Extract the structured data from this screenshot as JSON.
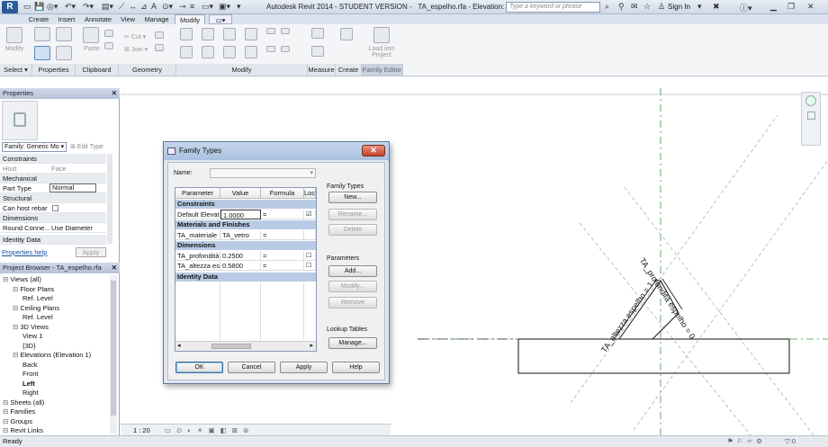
{
  "app": {
    "title": "Autodesk Revit 2014 - STUDENT VERSION -",
    "file": "TA_espelho.rfa - Elevation: Left",
    "app_button": "R"
  },
  "search": {
    "placeholder": "Type a keyword or phrase"
  },
  "user": {
    "sign_in": "Sign In"
  },
  "tabs": [
    "Create",
    "Insert",
    "Annotate",
    "View",
    "Manage",
    "Modify"
  ],
  "active_tab": "Modify",
  "ribbon": {
    "modify_label": "Modify",
    "paste_label": "Paste",
    "cut_label": "Cut",
    "join_label": "Join",
    "load_into_project": [
      "Load into",
      "Project"
    ],
    "panels": [
      "Select",
      "Properties",
      "Clipboard",
      "Geometry",
      "Modify",
      "Measure",
      "Create",
      "Family Editor"
    ]
  },
  "properties": {
    "title": "Properties",
    "family_type": "Family: Generic Mo",
    "edit_type": "Edit Type",
    "rows": [
      {
        "group": "Constraints"
      },
      {
        "name": "Host",
        "value": "Face"
      },
      {
        "group": "Mechanical"
      },
      {
        "name": "Part Type",
        "value": "Normal"
      },
      {
        "group": "Structural"
      },
      {
        "name": "Can host rebar",
        "value": ""
      },
      {
        "group": "Dimensions"
      },
      {
        "name": "Round Conne...",
        "value": "Use Diameter"
      },
      {
        "group": "Identity Data"
      }
    ],
    "help": "Properties help",
    "apply": "Apply"
  },
  "browser": {
    "title": "Project Browser - TA_espelho.rfa",
    "items": [
      {
        "label": "Views (all)",
        "level": 0
      },
      {
        "label": "Floor Plans",
        "level": 1
      },
      {
        "label": "Ref. Level",
        "level": 2
      },
      {
        "label": "Ceiling Plans",
        "level": 1
      },
      {
        "label": "Ref. Level",
        "level": 2
      },
      {
        "label": "3D Views",
        "level": 1
      },
      {
        "label": "View 1",
        "level": 2
      },
      {
        "label": "{3D}",
        "level": 2
      },
      {
        "label": "Elevations (Elevation 1)",
        "level": 1
      },
      {
        "label": "Back",
        "level": 2
      },
      {
        "label": "Front",
        "level": 2
      },
      {
        "label": "Left",
        "level": 2,
        "bold": true
      },
      {
        "label": "Right",
        "level": 2
      },
      {
        "label": "Sheets (all)",
        "level": 0
      },
      {
        "label": "Families",
        "level": 0
      },
      {
        "label": "Groups",
        "level": 0
      },
      {
        "label": "Revit Links",
        "level": 0
      }
    ]
  },
  "viewbar": {
    "scale": "1 : 20"
  },
  "status": {
    "text": "Ready",
    "zero": ":0"
  },
  "dialog": {
    "title": "Family Types",
    "name_label": "Name:",
    "columns": [
      "Parameter",
      "Value",
      "Formula",
      "Loc"
    ],
    "groups": [
      {
        "name": "Constraints",
        "rows": [
          {
            "param": "Default Elevati",
            "value": "1.0000",
            "formula": "=",
            "locked": true
          }
        ]
      },
      {
        "name": "Materials and Finishes",
        "rows": [
          {
            "param": "TA_materiale",
            "value": "TA_vetro",
            "formula": "=",
            "locked": null
          }
        ]
      },
      {
        "name": "Dimensions",
        "rows": [
          {
            "param": "TA_profondità",
            "value": "0.2500",
            "formula": "=",
            "locked": false
          },
          {
            "param": "TA_altezza esp",
            "value": "0.5800",
            "formula": "=",
            "locked": false
          }
        ]
      },
      {
        "name": "Identity Data",
        "rows": []
      }
    ],
    "family_types_label": "Family Types",
    "new": "New...",
    "rename": "Rename...",
    "delete": "Delete",
    "parameters_label": "Parameters",
    "add": "Add...",
    "modify": "Modify...",
    "remove": "Remove",
    "lookup_label": "Lookup Tables",
    "manage": "Manage...",
    "ok": "OK",
    "cancel": "Cancel",
    "apply": "Apply",
    "help": "Help"
  },
  "drawing": {
    "annotation_1": "TA_profondità espelho = 0",
    "annotation_2": "TA_altezza espelho = 1"
  }
}
